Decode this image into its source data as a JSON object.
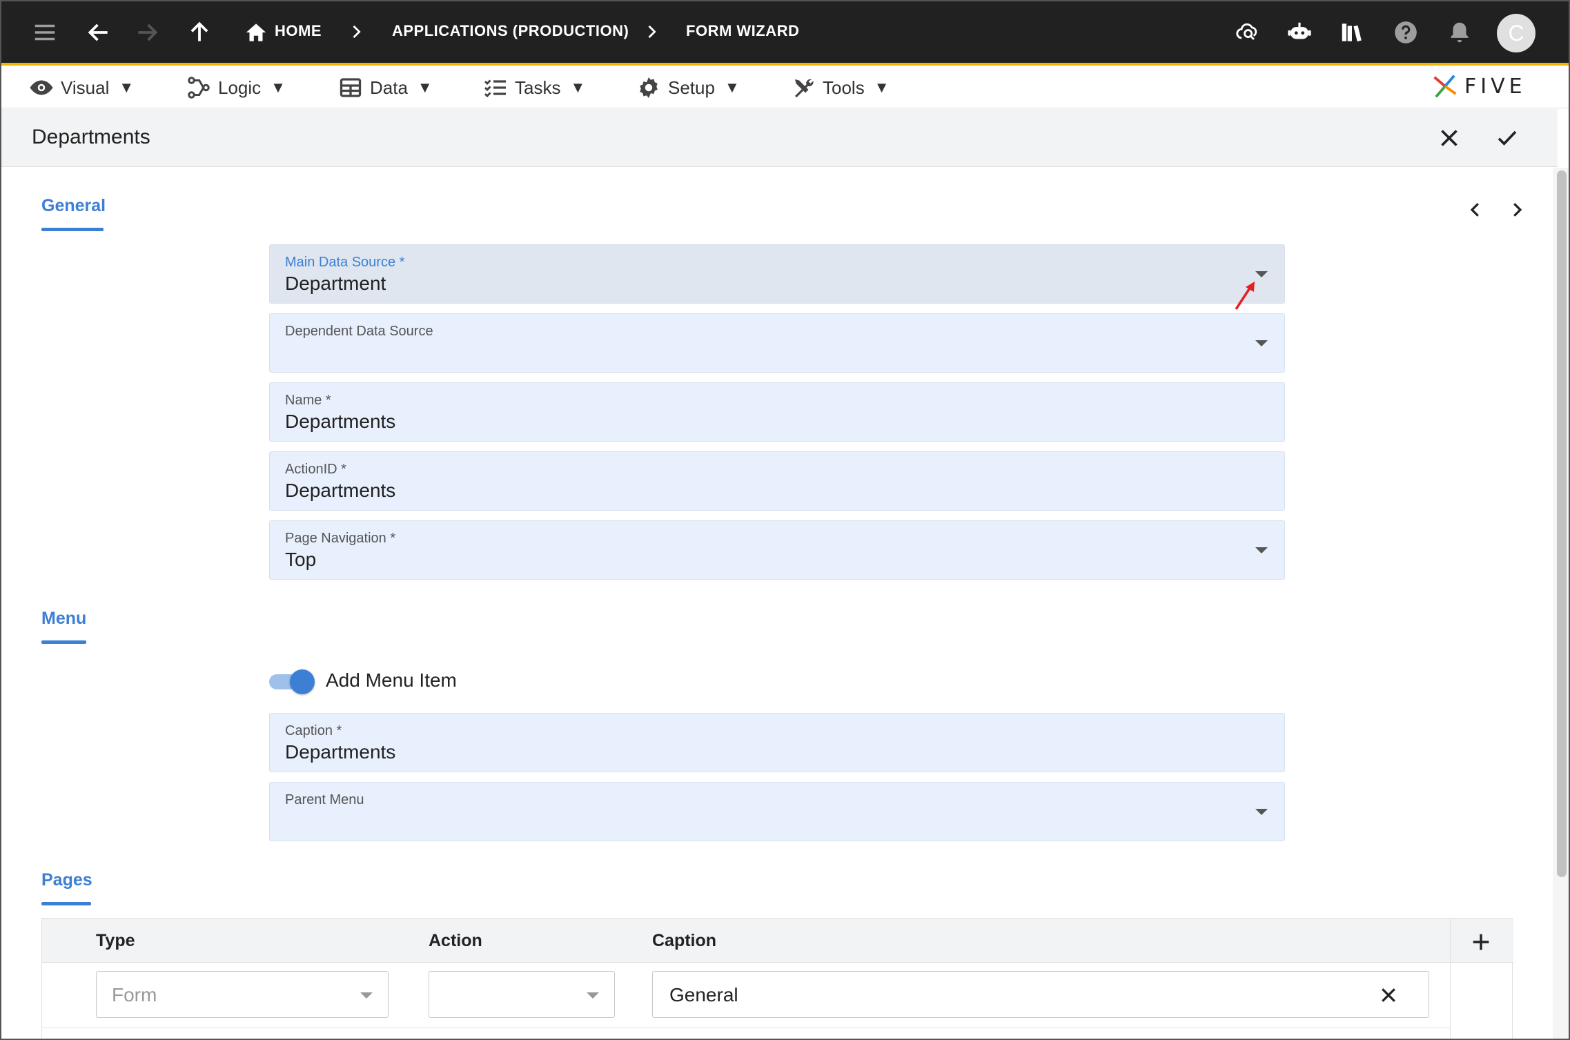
{
  "appbar": {
    "breadcrumbs": {
      "home": "HOME",
      "applications": "APPLICATIONS (PRODUCTION)",
      "form_wizard": "FORM WIZARD"
    },
    "avatar_letter": "C",
    "icons": [
      "menu-icon",
      "back-arrow-icon",
      "forward-arrow-icon",
      "up-arrow-icon",
      "home-icon",
      "cloud-search-icon",
      "chatbot-icon",
      "library-icon",
      "help-icon",
      "bell-icon"
    ]
  },
  "menubar": {
    "items": [
      {
        "label": "Visual",
        "icon": "eye-icon"
      },
      {
        "label": "Logic",
        "icon": "logic-icon"
      },
      {
        "label": "Data",
        "icon": "table-icon"
      },
      {
        "label": "Tasks",
        "icon": "tasks-icon"
      },
      {
        "label": "Setup",
        "icon": "gear-icon"
      },
      {
        "label": "Tools",
        "icon": "tools-icon"
      }
    ],
    "caret": "▼",
    "logo_text": "FIVE"
  },
  "form": {
    "title": "Departments"
  },
  "sections": {
    "general": "General",
    "menu": "Menu",
    "pages": "Pages"
  },
  "fields": {
    "main_data_source": {
      "label": "Main Data Source *",
      "value": "Department"
    },
    "dependent_data_source": {
      "label": "Dependent Data Source",
      "value": ""
    },
    "name": {
      "label": "Name *",
      "value": "Departments"
    },
    "action_id": {
      "label": "ActionID *",
      "value": "Departments"
    },
    "page_navigation": {
      "label": "Page Navigation *",
      "value": "Top"
    },
    "caption": {
      "label": "Caption *",
      "value": "Departments"
    },
    "parent_menu": {
      "label": "Parent Menu",
      "value": ""
    }
  },
  "menu_toggle": {
    "label": "Add Menu Item",
    "on": true
  },
  "pages_table": {
    "columns": [
      "Type",
      "Action",
      "Caption"
    ],
    "rows": [
      {
        "type": "Form",
        "action": "",
        "caption": "General"
      }
    ]
  },
  "colors": {
    "appbar_bg": "#212121",
    "accent": "#f5b400",
    "primary": "#3c7fd4",
    "field_bg": "#e8f0fd"
  }
}
